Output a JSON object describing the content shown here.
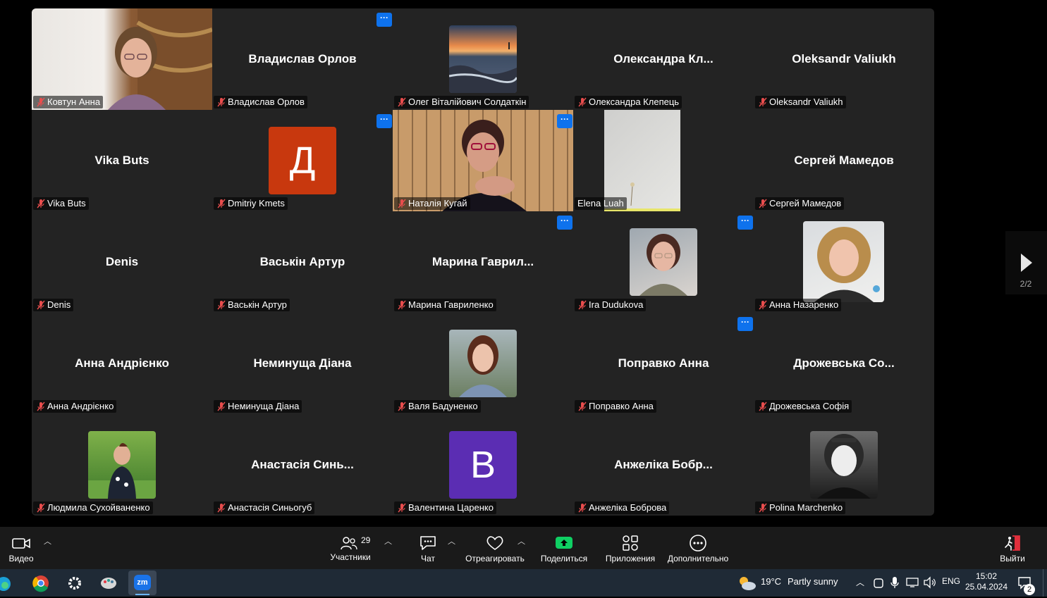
{
  "grid": {
    "page_indicator": "2/2",
    "tiles": [
      {
        "label": "Ковтун Анна",
        "center": "",
        "type": "video-anna"
      },
      {
        "label": "Владислав Орлов",
        "center": "Владислав Орлов",
        "type": "name"
      },
      {
        "label": "Олег Віталійович Солдаткін",
        "center": "",
        "type": "photo-sea"
      },
      {
        "label": "Олександра Клепець",
        "center": "Олександра Кл...",
        "type": "name"
      },
      {
        "label": "Oleksandr Valiukh",
        "center": "Oleksandr Valiukh",
        "type": "name"
      },
      {
        "label": "Vika Buts",
        "center": "Vika Buts",
        "type": "name"
      },
      {
        "label": "Dmitriy Kmets",
        "center": "",
        "type": "letter",
        "letter": "Д",
        "color": "#c8380e"
      },
      {
        "label": "Наталія Кугай",
        "center": "",
        "type": "video-natalia"
      },
      {
        "label": "Elena Luah",
        "center": "",
        "type": "video-wall"
      },
      {
        "label": "Сергей Мамедов",
        "center": "Сергей Мамедов",
        "type": "name"
      },
      {
        "label": "Denis",
        "center": "Denis",
        "type": "name"
      },
      {
        "label": "Васькін Артур",
        "center": "Васькін Артур",
        "type": "name"
      },
      {
        "label": "Марина Гавриленко",
        "center": "Марина Гаврил...",
        "type": "name"
      },
      {
        "label": "Ira Dudukova",
        "center": "",
        "type": "photo-girl1"
      },
      {
        "label": "Анна Назаренко",
        "center": "",
        "type": "photo-girl2"
      },
      {
        "label": "Анна Андрієнко",
        "center": "Анна Андрієнко",
        "type": "name"
      },
      {
        "label": "Неминуща Діана",
        "center": "Неминуща Діана",
        "type": "name"
      },
      {
        "label": "Валя Бадуненко",
        "center": "",
        "type": "photo-girl3"
      },
      {
        "label": "Поправко Анна",
        "center": "Поправко Анна",
        "type": "name"
      },
      {
        "label": "Дрожевська Софія",
        "center": "Дрожевська Со...",
        "type": "name"
      },
      {
        "label": "Людмила Сухойваненко",
        "center": "",
        "type": "photo-park"
      },
      {
        "label": "Анастасія Синьогуб",
        "center": "Анастасія Синь...",
        "type": "name"
      },
      {
        "label": "Валентина Царенко",
        "center": "",
        "type": "letter",
        "letter": "В",
        "color": "#5b2db3"
      },
      {
        "label": "Анжеліка Боброва",
        "center": "Анжеліка Бобр...",
        "type": "name"
      },
      {
        "label": "Polina Marchenko",
        "center": "",
        "type": "photo-bw"
      }
    ]
  },
  "toolbar": {
    "video_label": "Видео",
    "participants_label": "Участники",
    "participants_count": "29",
    "chat_label": "Чат",
    "react_label": "Отреагировать",
    "share_label": "Поделиться",
    "apps_label": "Приложения",
    "more_label": "Дополнительно",
    "leave_label": "Выйти",
    "more_glyph": "···",
    "accent_share": "#0fcf63",
    "accent_leave": "#e02f3c"
  },
  "taskbar": {
    "weather": "19°C",
    "weather_desc": "Partly sunny",
    "lang": "ENG",
    "time": "15:02",
    "date": "25.04.2024",
    "notifications": "2",
    "zoom_app": "zm"
  }
}
